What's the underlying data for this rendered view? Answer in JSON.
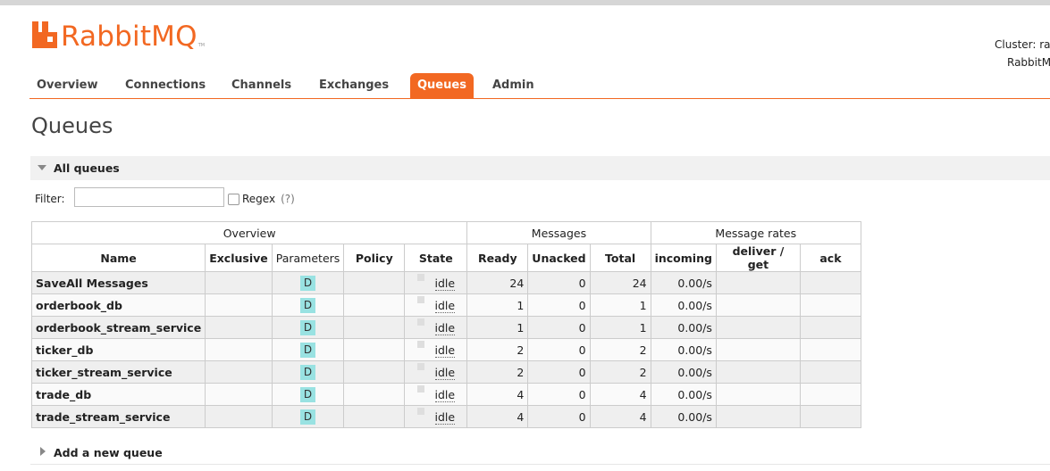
{
  "brand": {
    "name": "RabbitMQ",
    "tm": "TM",
    "color": "#f26822"
  },
  "cluster": {
    "line1": "Cluster: ra",
    "line2": "RabbitM"
  },
  "nav": {
    "tabs": [
      "Overview",
      "Connections",
      "Channels",
      "Exchanges",
      "Queues",
      "Admin"
    ],
    "active": "Queues"
  },
  "page": {
    "title": "Queues"
  },
  "section": {
    "label": "All queues",
    "add_label": "Add a new queue"
  },
  "filter": {
    "label": "Filter:",
    "value": "",
    "regex_label": "Regex",
    "help": "(?)"
  },
  "table": {
    "groups": [
      "Overview",
      "Messages",
      "Message rates"
    ],
    "columns": [
      "Name",
      "Exclusive",
      "Parameters",
      "Policy",
      "State",
      "Ready",
      "Unacked",
      "Total",
      "incoming",
      "deliver / get",
      "ack"
    ],
    "rows": [
      {
        "name": "SaveAll Messages",
        "exclusive": "",
        "param": "D",
        "policy": "",
        "state": "idle",
        "ready": "24",
        "unacked": "0",
        "total": "24",
        "incoming": "0.00/s",
        "deliver": "",
        "ack": ""
      },
      {
        "name": "orderbook_db",
        "exclusive": "",
        "param": "D",
        "policy": "",
        "state": "idle",
        "ready": "1",
        "unacked": "0",
        "total": "1",
        "incoming": "0.00/s",
        "deliver": "",
        "ack": ""
      },
      {
        "name": "orderbook_stream_service",
        "exclusive": "",
        "param": "D",
        "policy": "",
        "state": "idle",
        "ready": "1",
        "unacked": "0",
        "total": "1",
        "incoming": "0.00/s",
        "deliver": "",
        "ack": ""
      },
      {
        "name": "ticker_db",
        "exclusive": "",
        "param": "D",
        "policy": "",
        "state": "idle",
        "ready": "2",
        "unacked": "0",
        "total": "2",
        "incoming": "0.00/s",
        "deliver": "",
        "ack": ""
      },
      {
        "name": "ticker_stream_service",
        "exclusive": "",
        "param": "D",
        "policy": "",
        "state": "idle",
        "ready": "2",
        "unacked": "0",
        "total": "2",
        "incoming": "0.00/s",
        "deliver": "",
        "ack": ""
      },
      {
        "name": "trade_db",
        "exclusive": "",
        "param": "D",
        "policy": "",
        "state": "idle",
        "ready": "4",
        "unacked": "0",
        "total": "4",
        "incoming": "0.00/s",
        "deliver": "",
        "ack": ""
      },
      {
        "name": "trade_stream_service",
        "exclusive": "",
        "param": "D",
        "policy": "",
        "state": "idle",
        "ready": "4",
        "unacked": "0",
        "total": "4",
        "incoming": "0.00/s",
        "deliver": "",
        "ack": ""
      }
    ]
  }
}
